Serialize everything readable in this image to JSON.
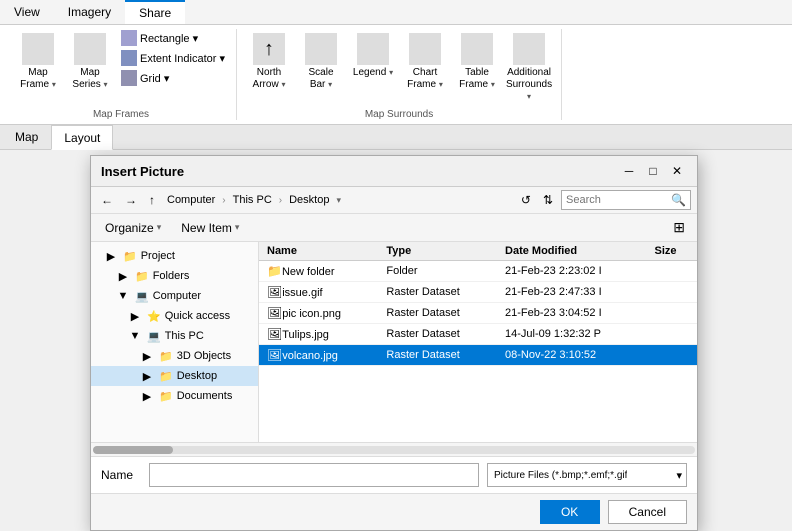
{
  "ribbon": {
    "tabs": [
      "View",
      "Imagery",
      "Share"
    ],
    "active_tab": "Share",
    "groups": [
      {
        "name": "map_frames_group",
        "label": "Map Frames",
        "items": [
          {
            "id": "map_frame",
            "label": "Map\nFrame",
            "type": "large-dropdown"
          },
          {
            "id": "map_series",
            "label": "Map\nSeries",
            "type": "large-dropdown"
          },
          {
            "id": "insert_group",
            "type": "small-col",
            "items": [
              {
                "id": "rectangle",
                "label": "Rectangle ▾"
              },
              {
                "id": "extent_indicator",
                "label": "Extent Indicator ▾"
              },
              {
                "id": "grid",
                "label": "Grid ▾"
              }
            ]
          }
        ]
      },
      {
        "name": "map_surrounds_group",
        "label": "Map Surrounds",
        "items": [
          {
            "id": "north_arrow",
            "label": "North\nArrow",
            "type": "large-dropdown"
          },
          {
            "id": "scale_bar",
            "label": "Scale\nBar",
            "type": "large-dropdown"
          },
          {
            "id": "legend",
            "label": "Legend",
            "type": "large-dropdown"
          },
          {
            "id": "chart_frame",
            "label": "Chart\nFrame",
            "type": "large-dropdown"
          },
          {
            "id": "table_frame",
            "label": "Table\nFrame",
            "type": "large-dropdown"
          },
          {
            "id": "additional_surrounds",
            "label": "Additional\nSurrounds",
            "type": "large-dropdown"
          }
        ]
      }
    ]
  },
  "view_tabs": [
    {
      "id": "map",
      "label": "Map"
    },
    {
      "id": "layout",
      "label": "Layout",
      "active": true
    }
  ],
  "dialog": {
    "title": "Insert Picture",
    "address_segments": [
      "Computer",
      "This PC",
      "Desktop"
    ],
    "search_placeholder": "Search",
    "organize_label": "Organize",
    "new_item_label": "New Item",
    "nav_items": [
      {
        "id": "project",
        "label": "Project",
        "indent": 1,
        "icon": "folder"
      },
      {
        "id": "folders",
        "label": "Folders",
        "indent": 2,
        "icon": "folder"
      },
      {
        "id": "computer",
        "label": "Computer",
        "indent": 2,
        "icon": "computer"
      },
      {
        "id": "quick_access",
        "label": "Quick access",
        "indent": 3,
        "icon": "star"
      },
      {
        "id": "this_pc",
        "label": "This PC",
        "indent": 3,
        "icon": "computer"
      },
      {
        "id": "3d_objects",
        "label": "3D Objects",
        "indent": 4,
        "icon": "folder"
      },
      {
        "id": "desktop",
        "label": "Desktop",
        "indent": 4,
        "icon": "folder",
        "selected": true
      },
      {
        "id": "documents",
        "label": "Documents",
        "indent": 4,
        "icon": "folder"
      }
    ],
    "columns": [
      {
        "id": "name",
        "label": "Name"
      },
      {
        "id": "type",
        "label": "Type"
      },
      {
        "id": "date_modified",
        "label": "Date Modified"
      },
      {
        "id": "size",
        "label": "Size"
      }
    ],
    "files": [
      {
        "name": "New folder",
        "type": "Folder",
        "date_modified": "21-Feb-23 2:23:02 I",
        "size": "",
        "icon": "folder",
        "selected": false
      },
      {
        "name": "issue.gif",
        "type": "Raster Dataset",
        "date_modified": "21-Feb-23 2:47:33 I",
        "size": "",
        "icon": "raster",
        "selected": false
      },
      {
        "name": "pic icon.png",
        "type": "Raster Dataset",
        "date_modified": "21-Feb-23 3:04:52 I",
        "size": "",
        "icon": "raster",
        "selected": false
      },
      {
        "name": "Tulips.jpg",
        "type": "Raster Dataset",
        "date_modified": "14-Jul-09 1:32:32 P",
        "size": "",
        "icon": "raster",
        "selected": false
      },
      {
        "name": "volcano.jpg",
        "type": "Raster Dataset",
        "date_modified": "08-Nov-22 3:10:52",
        "size": "",
        "icon": "raster",
        "selected": true
      }
    ],
    "name_label": "Name",
    "name_value": "",
    "filetype_label": "Picture Files (*.bmp;*.emf;*.gif",
    "ok_label": "OK",
    "cancel_label": "Cancel"
  },
  "icons": {
    "folder": "📁",
    "folder_yellow": "🗂",
    "computer": "💻",
    "star": "⭐",
    "raster": "🖼",
    "search": "🔍",
    "back": "←",
    "forward": "→",
    "up": "↑",
    "refresh": "↺",
    "close": "✕",
    "minimize": "─",
    "maximize": "□",
    "sort": "⇅"
  }
}
